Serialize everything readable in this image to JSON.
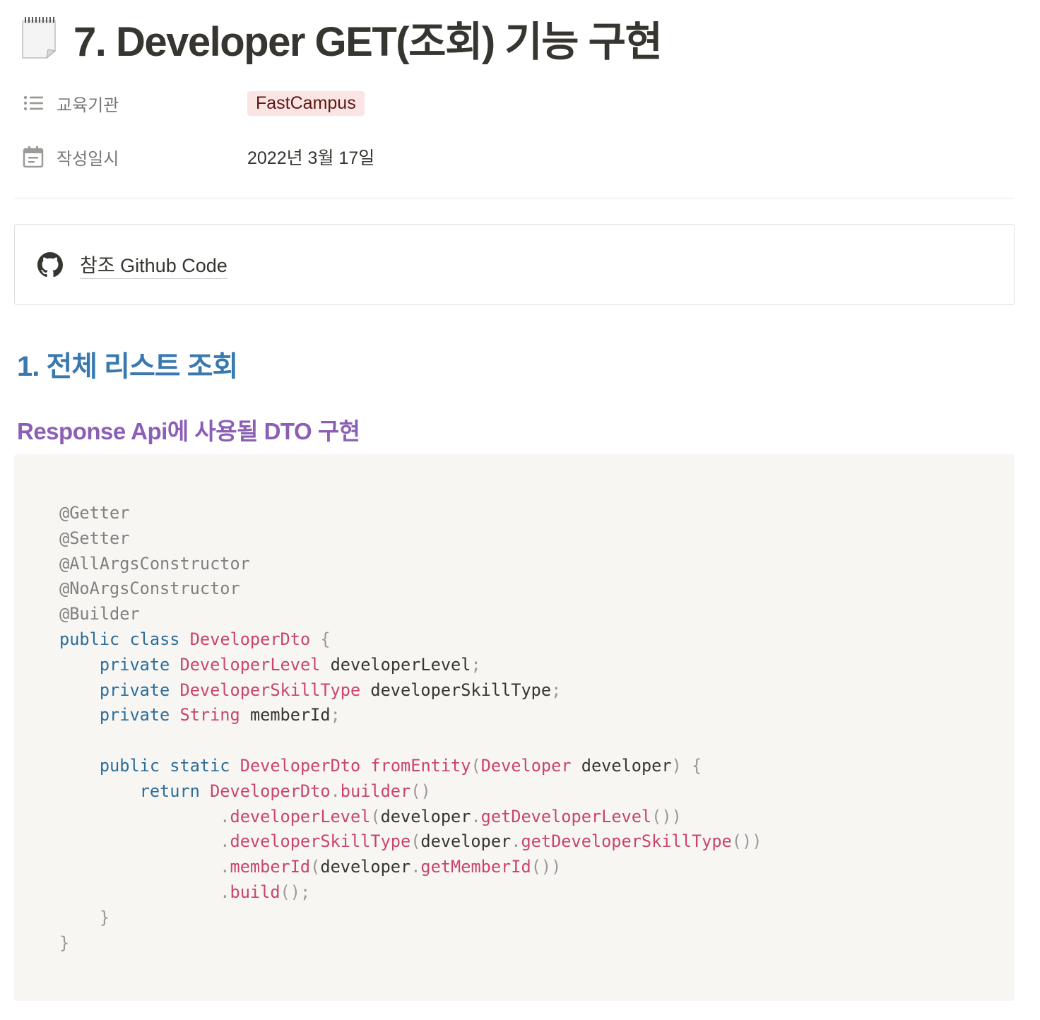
{
  "page": {
    "title": "7. Developer GET(조회) 기능 구현",
    "icon": "notepad-icon"
  },
  "properties": [
    {
      "icon": "list-icon",
      "label": "교육기관",
      "value": "FastCampus",
      "tag_color": "#fbe4e4"
    },
    {
      "icon": "calendar-icon",
      "label": "작성일시",
      "value": "2022년 3월 17일"
    }
  ],
  "bookmark": {
    "icon": "github-icon",
    "label": "참조 Github Code"
  },
  "heading1": "1. 전체 리스트 조회",
  "heading3": "Response Api에 사용될 DTO 구현",
  "code": {
    "language": "java",
    "lines": [
      "@Getter",
      "@Setter",
      "@AllArgsConstructor",
      "@NoArgsConstructor",
      "@Builder",
      "public class DeveloperDto {",
      "    private DeveloperLevel developerLevel;",
      "    private DeveloperSkillType developerSkillType;",
      "    private String memberId;",
      "",
      "    public static DeveloperDto fromEntity(Developer developer) {",
      "        return DeveloperDto.builder()",
      "                .developerLevel(developer.getDeveloperLevel())",
      "                .developerSkillType(developer.getDeveloperSkillType())",
      "                .memberId(developer.getMemberId())",
      "                .build();",
      "    }",
      "}"
    ]
  },
  "colors": {
    "heading1": "#3a79b0",
    "heading3": "#8b5fb6",
    "code_background": "#f7f6f3",
    "keyword": "#2b6d9b",
    "type": "#c9456a",
    "annotation": "#808080"
  }
}
